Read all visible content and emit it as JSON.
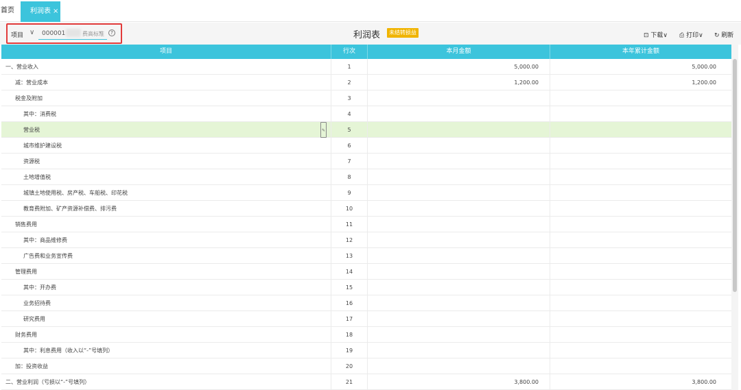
{
  "tabs": {
    "home": "首页",
    "active": "利润表",
    "close": "×"
  },
  "selector": {
    "label": "项目",
    "caret": "∨",
    "value_prefix": "000001",
    "value_suffix": "费高标准",
    "down": "▾",
    "help": "?"
  },
  "report": {
    "title": "利润表",
    "badge": "未结转损益"
  },
  "tools": {
    "download": "下载∨",
    "print": "打印∨",
    "refresh": "刷新"
  },
  "table": {
    "headers": [
      "项目",
      "行次",
      "本月金额",
      "本年累计金额"
    ],
    "rows": [
      {
        "name": "一、营业收入",
        "indent": 0,
        "line": "1",
        "month": "5,000.00",
        "year": "5,000.00"
      },
      {
        "name": "减：营业成本",
        "indent": 1,
        "line": "2",
        "month": "1,200.00",
        "year": "1,200.00"
      },
      {
        "name": "税金及附加",
        "indent": 1,
        "line": "3",
        "month": "",
        "year": ""
      },
      {
        "name": "其中：消费税",
        "indent": 2,
        "line": "4",
        "month": "",
        "year": ""
      },
      {
        "name": "营业税",
        "indent": 2,
        "line": "5",
        "month": "",
        "year": "",
        "highlight": true
      },
      {
        "name": "城市维护建设税",
        "indent": 2,
        "line": "6",
        "month": "",
        "year": ""
      },
      {
        "name": "资源税",
        "indent": 2,
        "line": "7",
        "month": "",
        "year": ""
      },
      {
        "name": "土地增值税",
        "indent": 2,
        "line": "8",
        "month": "",
        "year": ""
      },
      {
        "name": "城镇土地使用税、房产税、车船税、印花税",
        "indent": 2,
        "line": "9",
        "month": "",
        "year": ""
      },
      {
        "name": "教育费附加、矿产资源补偿费、排污费",
        "indent": 2,
        "line": "10",
        "month": "",
        "year": ""
      },
      {
        "name": "销售费用",
        "indent": 1,
        "line": "11",
        "month": "",
        "year": ""
      },
      {
        "name": "其中：商品维修费",
        "indent": 2,
        "line": "12",
        "month": "",
        "year": ""
      },
      {
        "name": "广告费和业务宣传费",
        "indent": 2,
        "line": "13",
        "month": "",
        "year": ""
      },
      {
        "name": "管理费用",
        "indent": 1,
        "line": "14",
        "month": "",
        "year": ""
      },
      {
        "name": "其中：开办费",
        "indent": 2,
        "line": "15",
        "month": "",
        "year": ""
      },
      {
        "name": "业务招待费",
        "indent": 2,
        "line": "16",
        "month": "",
        "year": ""
      },
      {
        "name": "研究费用",
        "indent": 2,
        "line": "17",
        "month": "",
        "year": ""
      },
      {
        "name": "财务费用",
        "indent": 1,
        "line": "18",
        "month": "",
        "year": ""
      },
      {
        "name": "其中：利息费用（收入以“-”号填列）",
        "indent": 2,
        "line": "19",
        "month": "",
        "year": ""
      },
      {
        "name": "加：投资收益",
        "indent": 1,
        "line": "20",
        "month": "",
        "year": ""
      },
      {
        "name": "二、营业利润（亏损以“-”号填列）",
        "indent": 0,
        "line": "21",
        "month": "3,800.00",
        "year": "3,800.00"
      }
    ]
  }
}
